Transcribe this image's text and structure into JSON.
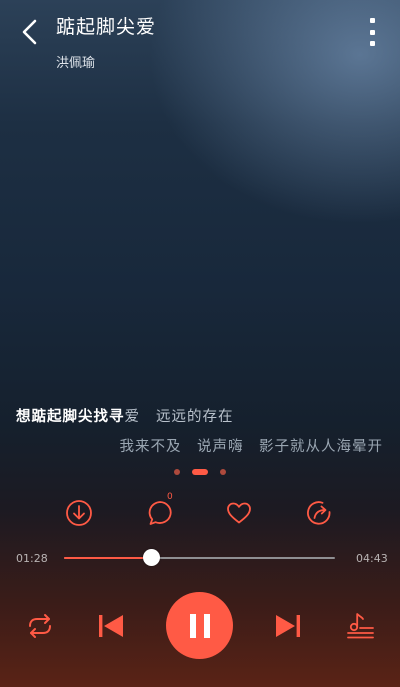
{
  "header": {
    "title": "踮起脚尖爱",
    "artist": "洪佩瑜"
  },
  "lyrics": {
    "line1_sung": "想踮起脚尖找寻",
    "line1_rest": "爱",
    "line1_next": "远远的存在",
    "line2": "我来不及　说声嗨　影子就从人海晕开"
  },
  "pager": {
    "count": 3,
    "active_index": 1
  },
  "actions": {
    "comment_count": "0"
  },
  "player": {
    "elapsed": "01:28",
    "total": "04:43",
    "progress": 0.32
  },
  "colors": {
    "accent": "#ff5a45",
    "track": "#8f8f92"
  },
  "icons": [
    "back-arrow-icon",
    "more-vertical-icon",
    "download-icon",
    "comment-icon",
    "heart-icon",
    "share-icon",
    "loop-icon",
    "previous-icon",
    "pause-icon",
    "next-icon",
    "playlist-icon"
  ]
}
